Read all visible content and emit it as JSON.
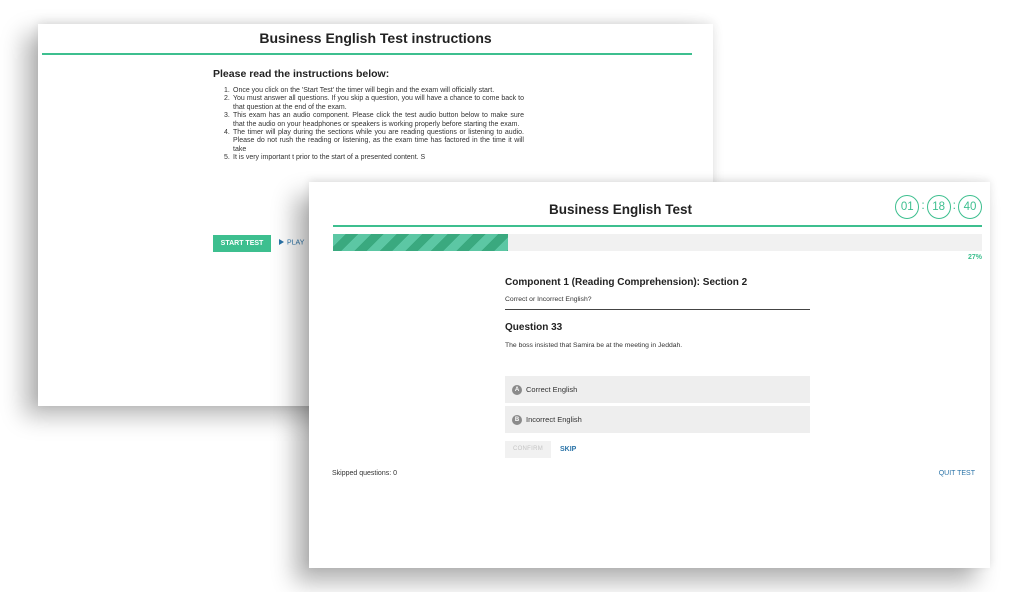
{
  "instructions_screen": {
    "title": "Business English Test instructions",
    "heading": "Please read the instructions below:",
    "items": [
      {
        "num": "1.",
        "text": "Once you click on the 'Start Test' the timer will begin and the exam will officially start."
      },
      {
        "num": "2.",
        "text": "You must answer all questions. If you skip a question, you will have a chance to come back to that question at the end of the exam."
      },
      {
        "num": "3.",
        "text": "This exam has an audio component. Please click the test audio button below to make sure that the audio on your headphones or speakers is working properly before starting the exam."
      },
      {
        "num": "4.",
        "text": "The timer will play during the sections while you are reading questions or listening to audio. Please do not rush the reading or listening, as the exam time has factored in the time it will take"
      },
      {
        "num": "5.",
        "text": "It is very important t prior to the start of a presented content. S"
      }
    ],
    "start_button": "START TEST",
    "play_audio": "PLAY"
  },
  "test_screen": {
    "title": "Business English Test",
    "timer": {
      "hours": "01",
      "minutes": "18",
      "seconds": "40"
    },
    "progress": {
      "percent": 27,
      "label": "27%"
    },
    "section_title": "Component 1 (Reading Comprehension): Section 2",
    "section_subtitle": "Correct or Incorrect English?",
    "question_title": "Question 33",
    "question_text": "The boss insisted that Samira be at the meeting in Jeddah.",
    "options": [
      {
        "letter": "A",
        "label": "Correct English"
      },
      {
        "letter": "B",
        "label": "Incorrect English"
      }
    ],
    "confirm_label": "CONFIRM",
    "skip_label": "SKIP",
    "skipped_questions": "Skipped questions: 0",
    "quit_label": "QUIT TEST"
  },
  "colors": {
    "accent_green": "#3dbf8f",
    "link_blue": "#2b74a8",
    "option_bg": "#eeeeee"
  },
  "icons": {
    "play": "play-triangle-icon",
    "option_a": "letter-a-circle-icon",
    "option_b": "letter-b-circle-icon"
  }
}
